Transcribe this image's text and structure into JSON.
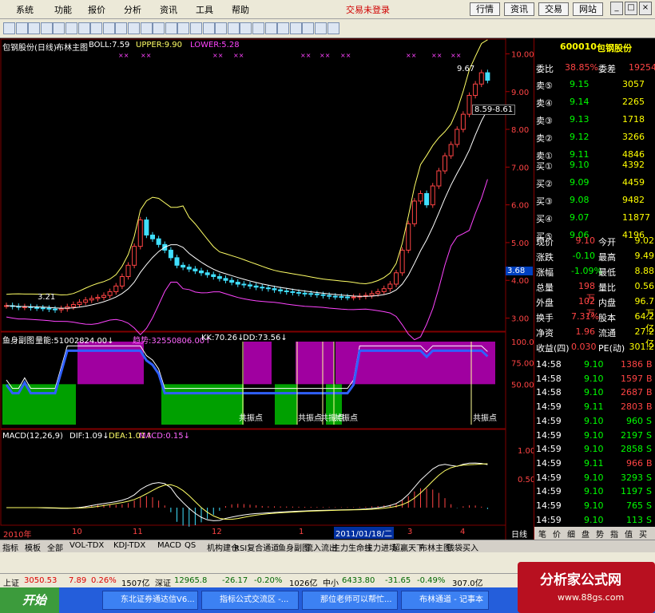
{
  "menubar": {
    "items": [
      "系统",
      "功能",
      "报价",
      "分析",
      "资讯",
      "工具",
      "帮助"
    ],
    "status": "交易未登录",
    "buttons": [
      "行情",
      "资讯",
      "交易",
      "网站"
    ]
  },
  "main": {
    "title": "包钢股份(日线)",
    "indicator": "布林主图",
    "boll": "BOLL:7.59",
    "upper": "UPPER:9.90",
    "lower": "LOWER:5.28",
    "yaxis": [
      "10.00",
      "9.00",
      "8.00",
      "7.00",
      "6.00",
      "5.00",
      "4.00",
      "3.00"
    ],
    "hi": "9.67",
    "lo": "3.21",
    "range": "8.59-8.61",
    "cur": "3.68"
  },
  "chart_data": {
    "type": "candlestick",
    "ylim": [
      2.8,
      10.2
    ],
    "close": [
      3.33,
      3.31,
      3.29,
      3.3,
      3.28,
      3.27,
      3.26,
      3.24,
      3.22,
      3.25,
      3.3,
      3.36,
      3.42,
      3.48,
      3.52,
      3.55,
      3.6,
      3.7,
      3.85,
      4.1,
      4.4,
      4.9,
      5.6,
      5.2,
      5.1,
      4.95,
      4.8,
      4.6,
      4.4,
      4.35,
      4.3,
      4.25,
      4.2,
      4.15,
      4.1,
      4.05,
      4.0,
      3.95,
      3.9,
      3.88,
      3.85,
      3.82,
      3.8,
      3.78,
      3.75,
      3.72,
      3.7,
      3.68,
      3.66,
      3.65,
      3.64,
      3.62,
      3.6,
      3.58,
      3.57,
      3.56,
      3.55,
      3.56,
      3.58,
      3.6,
      3.65,
      3.7,
      3.78,
      3.9,
      4.2,
      4.8,
      5.5,
      6.1,
      6.3,
      6.0,
      6.5,
      6.9,
      7.3,
      7.6,
      8.0,
      8.4,
      8.9,
      9.2,
      9.5,
      9.3
    ]
  },
  "sub1": {
    "title": "鱼身副图",
    "vol": "量能:51002824.00↓",
    "trend": "趋势:32550806.00↑",
    "kk": "KK:70.26↓",
    "dd": "DD:73.56↓",
    "yaxis": [
      "100.0",
      "75.00",
      "50.00"
    ],
    "resonance": [
      "共振点",
      "共振点",
      "共振点",
      "共振点",
      "共振点"
    ]
  },
  "sub2": {
    "title": "MACD(12,26,9)",
    "dif": "DIF:1.09↓",
    "dea": "DEA:1.01↑",
    "macd": "MACD:0.15↓",
    "yaxis": [
      "1.00",
      "0.50"
    ]
  },
  "xaxis": {
    "labels": [
      "2010年",
      "10",
      "11",
      "12",
      "1",
      "2011/01/18/二",
      "3",
      "4"
    ],
    "period": "日线"
  },
  "quote": {
    "code": "600010",
    "name": "包钢股份",
    "ratio_lbl": "委比",
    "ratio": "38.85%",
    "diff_lbl": "委差",
    "diff": "19254",
    "asks": [
      {
        "l": "卖⑤",
        "p": "9.15",
        "v": "3057"
      },
      {
        "l": "卖④",
        "p": "9.14",
        "v": "2265"
      },
      {
        "l": "卖③",
        "p": "9.13",
        "v": "1718"
      },
      {
        "l": "卖②",
        "p": "9.12",
        "v": "3266"
      },
      {
        "l": "卖①",
        "p": "9.11",
        "v": "4846"
      }
    ],
    "bids": [
      {
        "l": "买①",
        "p": "9.10",
        "v": "4392"
      },
      {
        "l": "买②",
        "p": "9.09",
        "v": "4459"
      },
      {
        "l": "买③",
        "p": "9.08",
        "v": "9482"
      },
      {
        "l": "买④",
        "p": "9.07",
        "v": "11877"
      },
      {
        "l": "买⑤",
        "p": "9.06",
        "v": "4196"
      }
    ],
    "stats": [
      [
        "现价",
        "9.10",
        "今开",
        "9.02"
      ],
      [
        "涨跌",
        "-0.10",
        "最高",
        "9.49"
      ],
      [
        "涨幅",
        "-1.09%",
        "最低",
        "8.88"
      ],
      [
        "总量",
        "198万",
        "量比",
        "0.56"
      ],
      [
        "外盘",
        "102万",
        "内盘",
        "96.7万"
      ],
      [
        "换手",
        "7.31%",
        "股本",
        "64.2亿"
      ],
      [
        "净资",
        "1.96",
        "流通",
        "27.2亿"
      ],
      [
        "收益(四)",
        "0.030",
        "PE(动)",
        "301.2"
      ]
    ],
    "ticks": [
      [
        "14:58",
        "9.10",
        "1386",
        "B"
      ],
      [
        "14:58",
        "9.10",
        "1597",
        "B"
      ],
      [
        "14:58",
        "9.10",
        "2687",
        "B"
      ],
      [
        "14:59",
        "9.11",
        "2803",
        "B"
      ],
      [
        "14:59",
        "9.10",
        "960",
        "S"
      ],
      [
        "14:59",
        "9.10",
        "2197",
        "S"
      ],
      [
        "14:59",
        "9.10",
        "2858",
        "S"
      ],
      [
        "14:59",
        "9.11",
        "966",
        "B"
      ],
      [
        "14:59",
        "9.10",
        "3293",
        "S"
      ],
      [
        "14:59",
        "9.10",
        "1197",
        "S"
      ],
      [
        "14:59",
        "9.10",
        "765",
        "S"
      ],
      [
        "14:59",
        "9.10",
        "113",
        "S"
      ]
    ],
    "tabs": [
      "笔",
      "价",
      "细",
      "盘",
      "势",
      "指",
      "值",
      "买"
    ]
  },
  "tabs": [
    "指标",
    "模板",
    "全部",
    "VOL-TDX",
    "KDJ-TDX",
    "MACD",
    "QS",
    "机构建仓",
    "RSI复合通道",
    "鱼身副图",
    "流入流出",
    "主力生命线",
    "主力进场",
    "超赢天下",
    "布林主图",
    "钱袋买入"
  ],
  "status": {
    "sh": "上证",
    "sh_v": "3050.53",
    "sh_c": "7.89",
    "sh_p": "0.26%",
    "sh_a": "1507亿",
    "sz": "深证",
    "sz_v": "12965.8",
    "sz_c": "-26.17",
    "sz_p": "-0.20%",
    "sz_a": "1026亿",
    "zx": "中小",
    "zx_v": "6433.80",
    "zx_c": "-31.65",
    "zx_p": "-0.49%",
    "zx_a": "307.0亿"
  },
  "taskbar": {
    "start": "开始",
    "tasks": [
      "东北证券通达信V6...",
      "指标公式交流区 -...",
      "那位老师可以帮忙...",
      "布林通道 - 记事本"
    ]
  },
  "brand": {
    "name": "分析家公式网",
    "url": "www.88gs.com"
  }
}
